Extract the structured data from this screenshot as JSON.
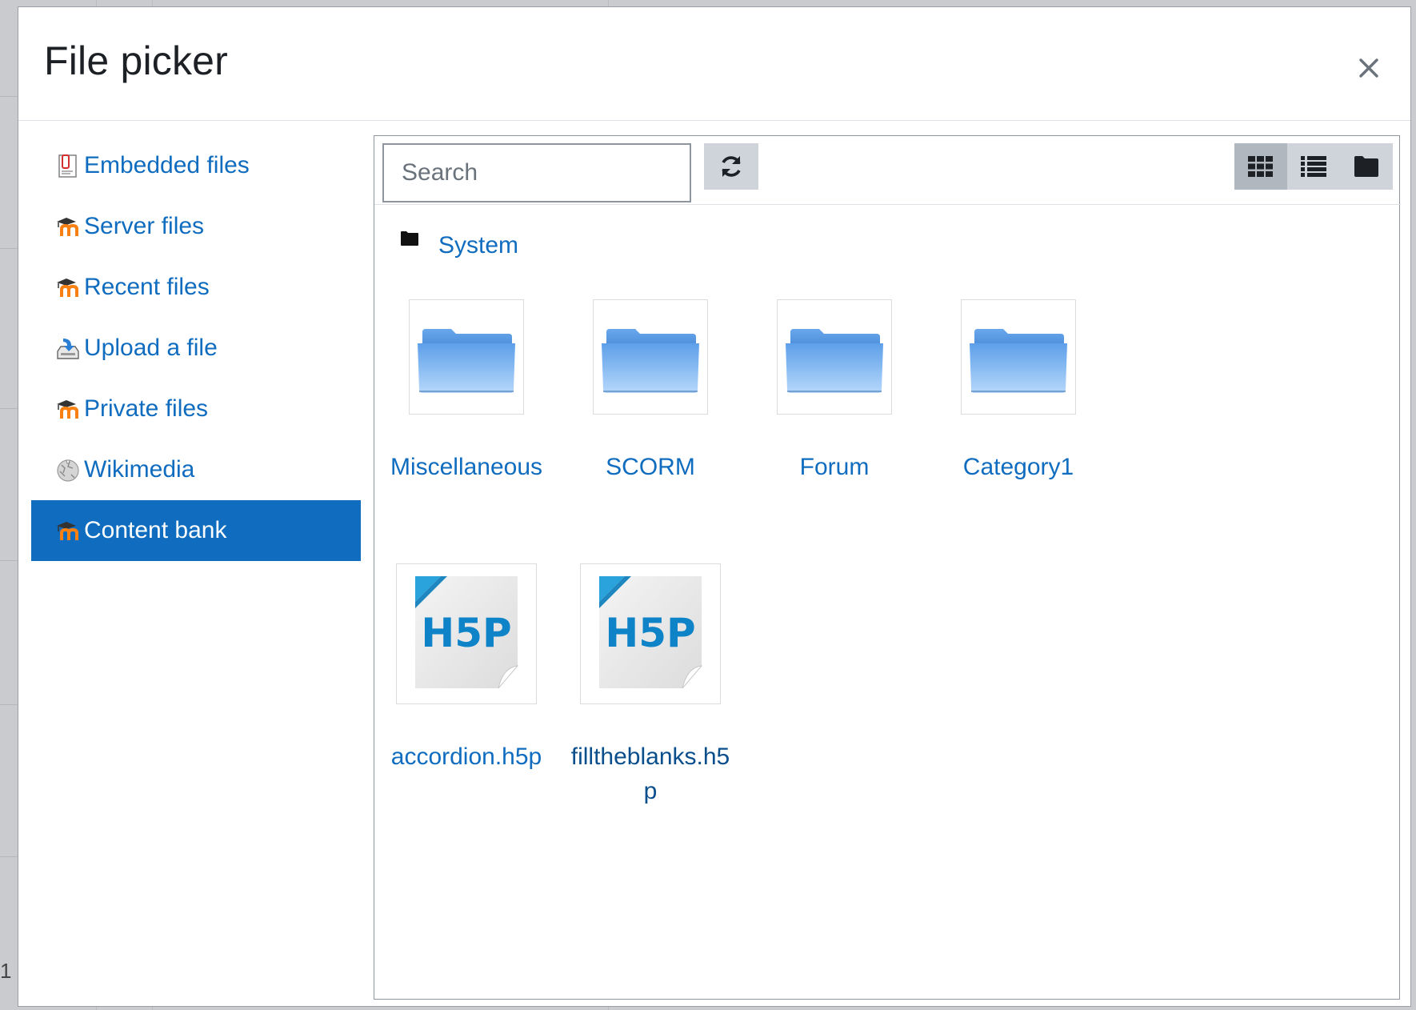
{
  "dialog": {
    "title": "File picker",
    "close_label": "×"
  },
  "repositories": [
    {
      "label": "Embedded files",
      "icon": "embedded-files-icon",
      "active": false
    },
    {
      "label": "Server files",
      "icon": "moodle-icon",
      "active": false
    },
    {
      "label": "Recent files",
      "icon": "moodle-icon",
      "active": false
    },
    {
      "label": "Upload a file",
      "icon": "upload-icon",
      "active": false
    },
    {
      "label": "Private files",
      "icon": "moodle-icon",
      "active": false
    },
    {
      "label": "Wikimedia",
      "icon": "wikimedia-icon",
      "active": false
    },
    {
      "label": "Content bank",
      "icon": "moodle-icon",
      "active": true
    }
  ],
  "toolbar": {
    "search_placeholder": "Search",
    "refresh_icon": "refresh-icon",
    "views": [
      {
        "name": "icons-view",
        "icon": "grid-icon",
        "active": true
      },
      {
        "name": "list-view",
        "icon": "list-icon",
        "active": false
      },
      {
        "name": "tree-view",
        "icon": "folder-icon",
        "active": false
      }
    ]
  },
  "path": {
    "label": "System"
  },
  "items": [
    {
      "name": "Miscellaneous",
      "type": "folder"
    },
    {
      "name": "SCORM",
      "type": "folder"
    },
    {
      "name": "Forum",
      "type": "folder"
    },
    {
      "name": "Category1",
      "type": "folder"
    },
    {
      "name": "accordion.h5p",
      "type": "h5p"
    },
    {
      "name": "filltheblanks.h5p",
      "type": "h5p"
    }
  ],
  "colors": {
    "link": "#0f6cbf",
    "active_bg": "#0f6cbf",
    "button_bg": "#ced4da",
    "folder_blue": "#6aaef0"
  }
}
